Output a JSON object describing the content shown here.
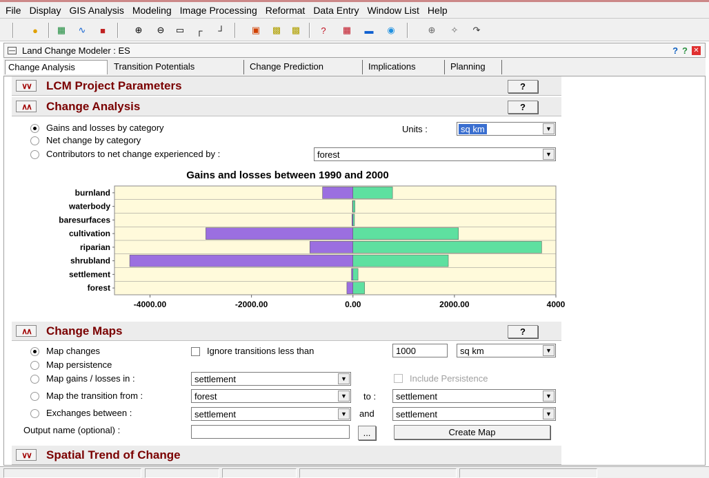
{
  "menu": [
    "File",
    "Display",
    "GIS Analysis",
    "Modeling",
    "Image Processing",
    "Reformat",
    "Data Entry",
    "Window List",
    "Help"
  ],
  "window": {
    "title": "Land Change Modeler : ES"
  },
  "tabs": [
    "Change Analysis",
    "Transition Potentials",
    "Change Prediction",
    "Implications",
    "Planning"
  ],
  "sections": {
    "project": "LCM Project Parameters",
    "change_analysis": "Change Analysis",
    "change_maps": "Change Maps",
    "spatial_trend": "Spatial Trend of Change"
  },
  "help_label": "?",
  "analysis": {
    "opt_gains": "Gains and losses by category",
    "opt_net": "Net change by category",
    "opt_contrib": "Contributors to net change experienced by :",
    "units_label": "Units :",
    "units_value": "sq km",
    "contrib_value": "forest"
  },
  "chart_data": {
    "type": "bar",
    "orientation": "horizontal",
    "title": "Gains and losses between 1990 and 2000",
    "categories": [
      "burnland",
      "waterbody",
      "baresurfaces",
      "cultivation",
      "riparian",
      "shrubland",
      "settlement",
      "forest"
    ],
    "series": [
      {
        "color": "#9b6fe0",
        "values": [
          -600,
          -10,
          -20,
          -2900,
          -850,
          -4400,
          -30,
          -120
        ]
      },
      {
        "color": "#5ee0a0",
        "values": [
          780,
          40,
          30,
          2080,
          3720,
          1880,
          100,
          230
        ]
      }
    ],
    "xlim": [
      -4700,
      4000
    ],
    "ticks": [
      "-4000.00",
      "-2000.00",
      "0.00",
      "2000.00",
      "4000"
    ],
    "tick_values": [
      -4000,
      -2000,
      0,
      2000,
      4000
    ],
    "plot_bg": "#fffadb"
  },
  "maps": {
    "opt_map_changes": "Map changes",
    "ignore_label": "Ignore transitions less than",
    "ignore_value": "1000",
    "ignore_units": "sq km",
    "opt_persistence": "Map persistence",
    "opt_gains_losses": "Map gains / losses in :",
    "gains_losses_value": "settlement",
    "include_persistence": "Include Persistence",
    "opt_transition": "Map the transition from :",
    "transition_from": "forest",
    "to_label": "to :",
    "transition_to": "settlement",
    "opt_exchanges": "Exchanges between :",
    "exchange_a": "settlement",
    "and_label": "and",
    "exchange_b": "settlement",
    "output_label": "Output name (optional) :",
    "output_value": "",
    "browse_label": "...",
    "create_label": "Create Map"
  }
}
